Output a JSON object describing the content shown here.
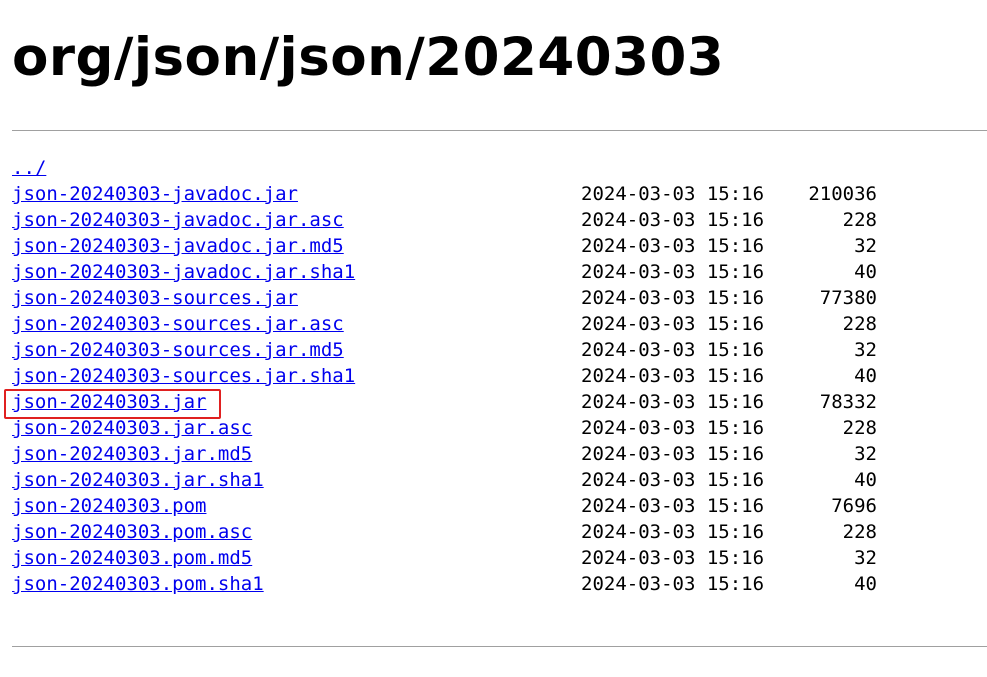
{
  "page": {
    "title": "org/json/json/20240303",
    "parent_link": "../"
  },
  "entries": [
    {
      "name": "json-20240303-javadoc.jar",
      "date": "2024-03-03 15:16",
      "size": "210036"
    },
    {
      "name": "json-20240303-javadoc.jar.asc",
      "date": "2024-03-03 15:16",
      "size": "228"
    },
    {
      "name": "json-20240303-javadoc.jar.md5",
      "date": "2024-03-03 15:16",
      "size": "32"
    },
    {
      "name": "json-20240303-javadoc.jar.sha1",
      "date": "2024-03-03 15:16",
      "size": "40"
    },
    {
      "name": "json-20240303-sources.jar",
      "date": "2024-03-03 15:16",
      "size": "77380"
    },
    {
      "name": "json-20240303-sources.jar.asc",
      "date": "2024-03-03 15:16",
      "size": "228"
    },
    {
      "name": "json-20240303-sources.jar.md5",
      "date": "2024-03-03 15:16",
      "size": "32"
    },
    {
      "name": "json-20240303-sources.jar.sha1",
      "date": "2024-03-03 15:16",
      "size": "40"
    },
    {
      "name": "json-20240303.jar",
      "date": "2024-03-03 15:16",
      "size": "78332"
    },
    {
      "name": "json-20240303.jar.asc",
      "date": "2024-03-03 15:16",
      "size": "228"
    },
    {
      "name": "json-20240303.jar.md5",
      "date": "2024-03-03 15:16",
      "size": "32"
    },
    {
      "name": "json-20240303.jar.sha1",
      "date": "2024-03-03 15:16",
      "size": "40"
    },
    {
      "name": "json-20240303.pom",
      "date": "2024-03-03 15:16",
      "size": "7696"
    },
    {
      "name": "json-20240303.pom.asc",
      "date": "2024-03-03 15:16",
      "size": "228"
    },
    {
      "name": "json-20240303.pom.md5",
      "date": "2024-03-03 15:16",
      "size": "32"
    },
    {
      "name": "json-20240303.pom.sha1",
      "date": "2024-03-03 15:16",
      "size": "40"
    }
  ],
  "highlight": {
    "target": "json-20240303.jar",
    "color": "#e02020"
  },
  "colors": {
    "link": "#0000ee",
    "rule": "#a0a0a0"
  }
}
